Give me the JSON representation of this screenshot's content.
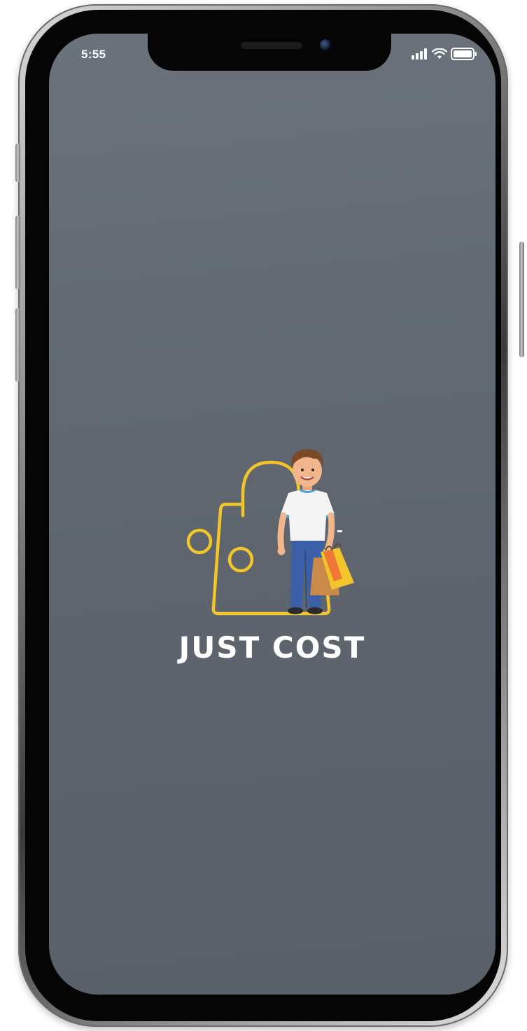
{
  "status_bar": {
    "time": "5:55",
    "icons": [
      "signal-bars-icon",
      "wifi-icon",
      "battery-icon"
    ]
  },
  "splash": {
    "app_name": "JUST COST",
    "logo_icon": "shopping-bag-logo-icon",
    "mascot_icon": "shopper-man-illustration"
  },
  "colors": {
    "background": "#61676f",
    "logo_accent": "#f2c62a",
    "text": "#ffffff"
  }
}
